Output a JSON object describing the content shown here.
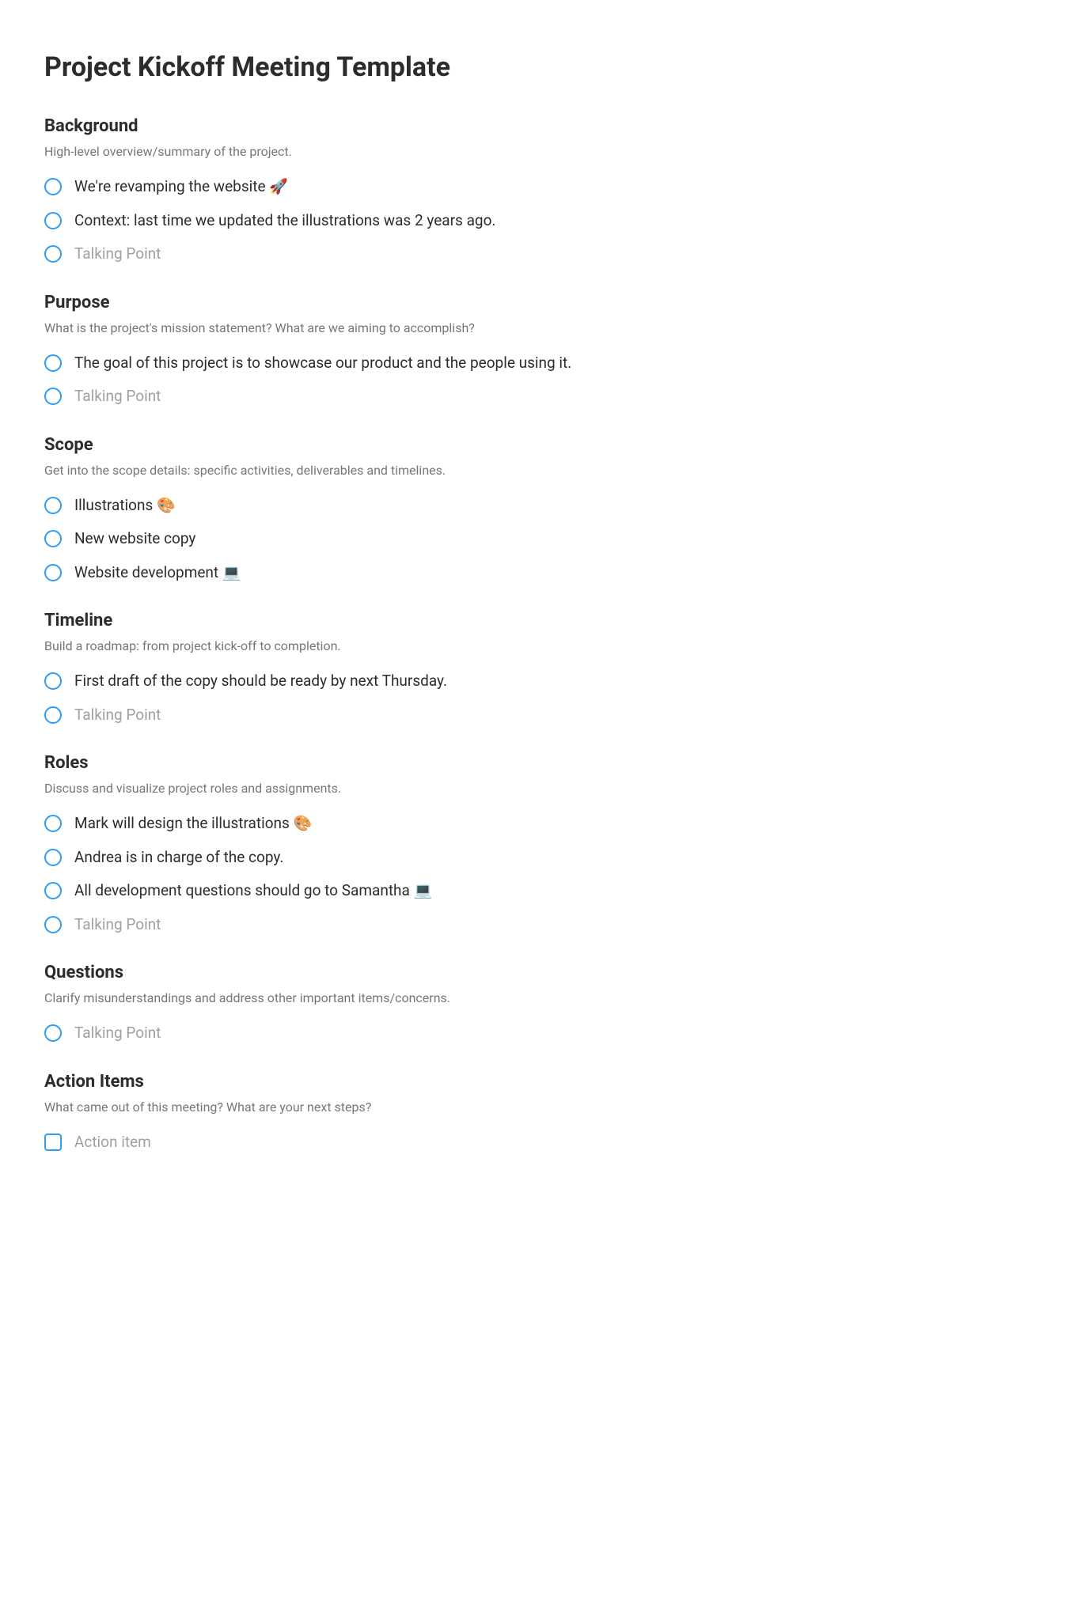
{
  "title": "Project Kickoff Meeting Template",
  "sections": [
    {
      "title": "Background",
      "desc": "High-level overview/summary of the project.",
      "items": [
        {
          "text": "We're revamping the website 🚀",
          "placeholder": false,
          "type": "radio"
        },
        {
          "text": "Context: last time we updated the illustrations was 2 years ago.",
          "placeholder": false,
          "type": "radio"
        },
        {
          "text": "Talking Point",
          "placeholder": true,
          "type": "radio"
        }
      ]
    },
    {
      "title": "Purpose",
      "desc": "What is the project's mission statement? What are we aiming to accomplish?",
      "items": [
        {
          "text": "The goal of this project is to showcase our product and the people using it.",
          "placeholder": false,
          "type": "radio"
        },
        {
          "text": "Talking Point",
          "placeholder": true,
          "type": "radio"
        }
      ]
    },
    {
      "title": "Scope",
      "desc": "Get into the scope details: specific activities, deliverables and timelines.",
      "items": [
        {
          "text": "Illustrations 🎨",
          "placeholder": false,
          "type": "radio"
        },
        {
          "text": "New website copy",
          "placeholder": false,
          "type": "radio"
        },
        {
          "text": "Website development 💻",
          "placeholder": false,
          "type": "radio"
        }
      ]
    },
    {
      "title": "Timeline",
      "desc": "Build a roadmap: from project kick-off to completion.",
      "items": [
        {
          "text": "First draft of the copy should be ready by next Thursday.",
          "placeholder": false,
          "type": "radio"
        },
        {
          "text": "Talking Point",
          "placeholder": true,
          "type": "radio"
        }
      ]
    },
    {
      "title": "Roles",
      "desc": "Discuss and visualize project roles and assignments.",
      "items": [
        {
          "text": "Mark will design the illustrations 🎨",
          "placeholder": false,
          "type": "radio"
        },
        {
          "text": "Andrea is in charge of the copy.",
          "placeholder": false,
          "type": "radio"
        },
        {
          "text": "All development questions should go to Samantha 💻",
          "placeholder": false,
          "type": "radio"
        },
        {
          "text": "Talking Point",
          "placeholder": true,
          "type": "radio"
        }
      ]
    },
    {
      "title": "Questions",
      "desc": "Clarify misunderstandings and address other important items/concerns.",
      "items": [
        {
          "text": "Talking Point",
          "placeholder": true,
          "type": "radio"
        }
      ]
    },
    {
      "title": "Action Items",
      "desc": "What came out of this meeting? What are your next steps?",
      "items": [
        {
          "text": "Action item",
          "placeholder": true,
          "type": "checkbox"
        }
      ]
    }
  ]
}
